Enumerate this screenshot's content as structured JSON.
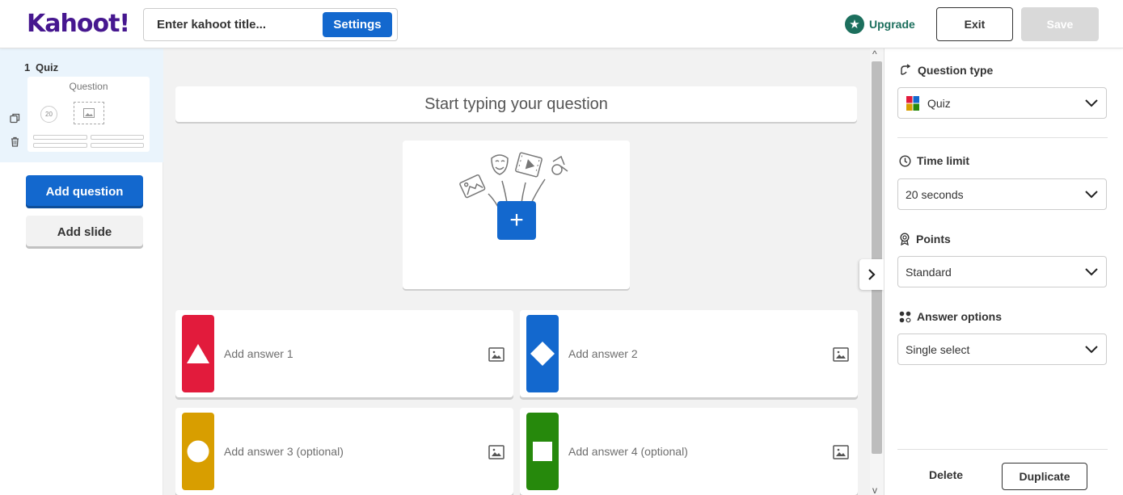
{
  "header": {
    "logo": "Kahoot!",
    "title_placeholder": "Enter kahoot title...",
    "settings_label": "Settings",
    "upgrade_label": "Upgrade",
    "exit_label": "Exit",
    "save_label": "Save"
  },
  "sidebar": {
    "slide": {
      "number": "1",
      "type": "Quiz",
      "thumb_label": "Question",
      "thumb_timer": "20"
    },
    "add_question_label": "Add question",
    "add_slide_label": "Add slide"
  },
  "editor": {
    "question_placeholder": "Start typing your question",
    "answers": [
      {
        "label": "Add answer 1",
        "color": "#e21b3c",
        "shape": "triangle-icon"
      },
      {
        "label": "Add answer 2",
        "color": "#1368ce",
        "shape": "diamond-icon"
      },
      {
        "label": "Add answer 3 (optional)",
        "color": "#d89e00",
        "shape": "circle-icon"
      },
      {
        "label": "Add answer 4 (optional)",
        "color": "#26890c",
        "shape": "square-icon"
      }
    ]
  },
  "panel": {
    "question_type_label": "Question type",
    "question_type_value": "Quiz",
    "time_limit_label": "Time limit",
    "time_limit_value": "20 seconds",
    "points_label": "Points",
    "points_value": "Standard",
    "answer_options_label": "Answer options",
    "answer_options_value": "Single select",
    "delete_label": "Delete",
    "duplicate_label": "Duplicate"
  },
  "colors": {
    "brand": "#46178f",
    "primary": "#1368ce",
    "upgrade": "#1c6f5d"
  }
}
